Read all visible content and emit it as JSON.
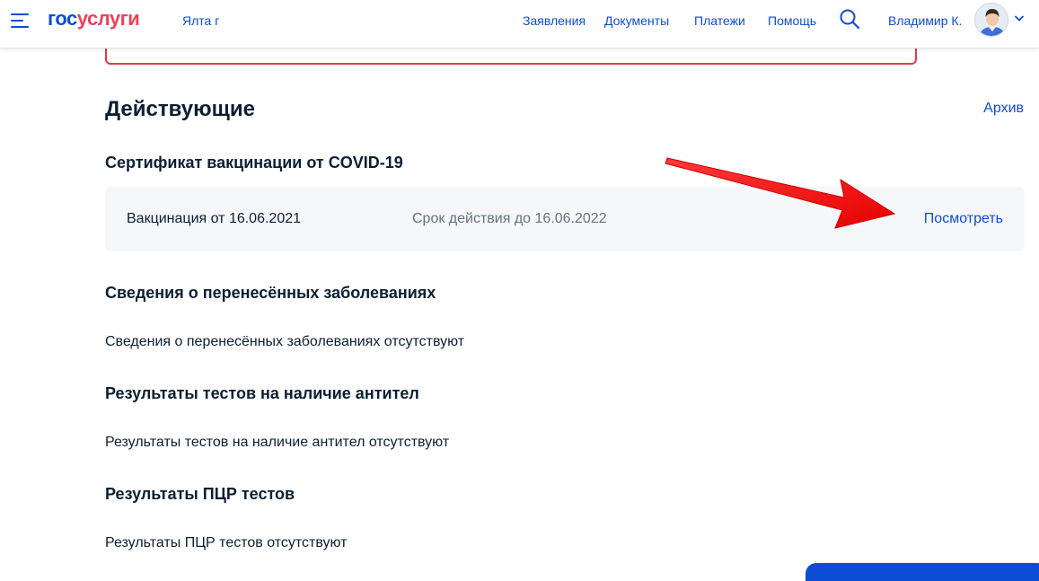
{
  "header": {
    "logo_part1": "гос",
    "logo_part2": "услуги",
    "region": "Ялта г",
    "nav": [
      "Заявления",
      "Документы",
      "Платежи",
      "Помощь"
    ],
    "user_name": "Владимир К."
  },
  "main": {
    "section_title": "Действующие",
    "archive_link": "Архив",
    "certificate": {
      "title": "Сертификат вакцинации от COVID-19",
      "vaccination_date": "Вакцинация от 16.06.2021",
      "valid_until": "Срок действия до 16.06.2022",
      "view_link": "Посмотреть"
    },
    "diseases": {
      "title": "Сведения о перенесённых заболеваниях",
      "text": "Сведения о перенесённых заболеваниях отсутствуют"
    },
    "antibodies": {
      "title": "Результаты тестов на наличие антител",
      "text": "Результаты тестов на наличие антител отсутствуют"
    },
    "pcr": {
      "title": "Результаты ПЦР тестов",
      "text": "Результаты ПЦР тестов отсутствуют"
    }
  },
  "colors": {
    "brand_blue": "#0d4cd3",
    "brand_red": "#ee3f58",
    "annotation_arrow": "#ff1a1a"
  },
  "icons": [
    "menu-icon",
    "search-icon",
    "avatar",
    "chevron-down-icon",
    "red-arrow-annotation"
  ]
}
